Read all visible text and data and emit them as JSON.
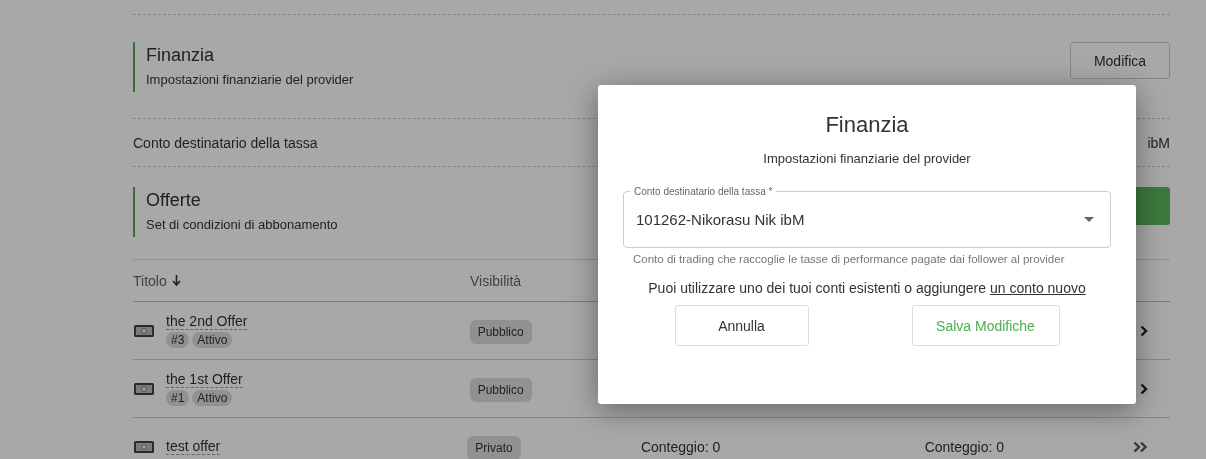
{
  "finance": {
    "title": "Finanzia",
    "subtitle": "Impostazioni finanziarie del provider",
    "edit_button": "Modifica",
    "field_label": "Conto destinatario della tassa",
    "field_value": "ibM"
  },
  "offers": {
    "title": "Offerte",
    "subtitle": "Set di condizioni di abbonamento",
    "columns": [
      "Titolo",
      "Visibilità"
    ],
    "rows": [
      {
        "title": "the 2nd Offer",
        "tags": [
          "#3",
          "Attivo"
        ],
        "visibility": "Pubblico",
        "kind": "single"
      },
      {
        "title": "the 1st Offer",
        "tags": [
          "#1",
          "Attivo"
        ],
        "visibility": "Pubblico",
        "kind": "single"
      },
      {
        "title": "test offer",
        "tags": [],
        "visibility": "Privato",
        "column_3": "Conteggio: 0",
        "column_4": "Conteggio: 0",
        "kind": "double"
      }
    ]
  },
  "dialog": {
    "title": "Finanzia",
    "subtitle": "Impostazioni finanziarie del provider",
    "field_label": "Conto destinatario della tassa *",
    "field_value": "101262-Nikorasu Nik ibM",
    "helper": "Conto di trading che raccoglie le tasse di performance pagate dai follower al provider",
    "note": "Puoi utilizzare uno dei tuoi conti esistenti o aggiungere",
    "note_link": "un conto nuovo",
    "buttons": [
      "Annulla",
      "Salva Modifiche"
    ]
  }
}
